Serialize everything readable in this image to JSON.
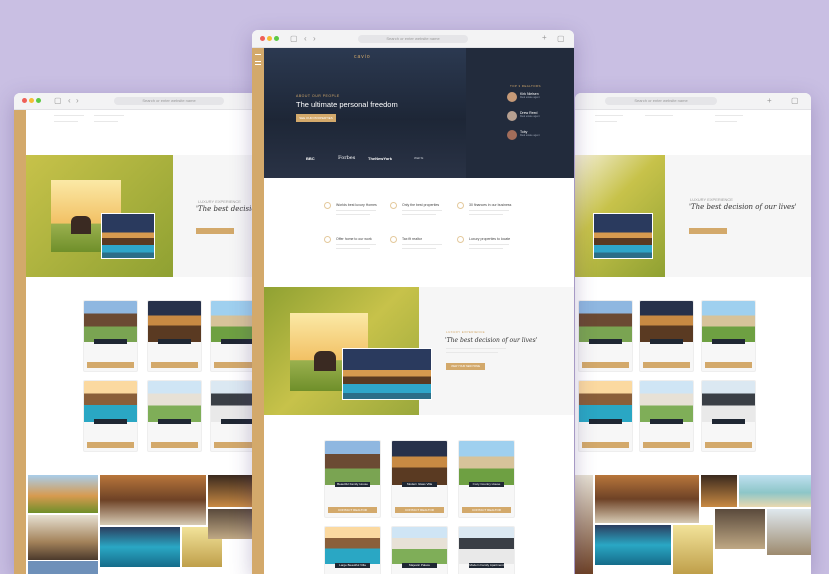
{
  "main": {
    "url": "Search or enter website name",
    "brand": "cavio",
    "eyebrow": "ABOUT OUR PEOPLE",
    "hero_title": "The ultimate personal freedom",
    "hero_button": "SEE OUR PROPERTIES",
    "team_heading": "TOP 3 REALTORS",
    "realtors": [
      {
        "name": "Kirk Nielsen",
        "role": "Real estate agent"
      },
      {
        "name": "Drew Reed",
        "role": "Real estate agent"
      },
      {
        "name": "Toby",
        "role": "Real estate agent"
      }
    ],
    "press": [
      "BBC",
      "Forbes",
      "TheNewYork",
      "Wall St"
    ],
    "features": [
      "Worlds best luxury Homes",
      "Only the best properties",
      "30 finances in our business",
      "Offer home to our work",
      "Tax fit realtor",
      "Luxury properties to locate"
    ],
    "quote_eyebrow": "LUXURY EXPERIENCE",
    "quote": "'The best decision of our lives'",
    "quote_button": "VIEW YOUR NEW HOME",
    "listings": [
      "Beautiful Family House",
      "Modern Glass Villa",
      "Cozy Country House",
      "Large Beautiful Villa",
      "Majestic Palace",
      "Modern Family Apartment"
    ],
    "listing_button": "CONTACT REALTOR"
  },
  "right": {
    "quote": "'The best decision of our lives'"
  },
  "left": {
    "quote": "'The best decision o"
  },
  "colors": {
    "background": "#c9bfe3",
    "accent": "#d3a96b",
    "hero": "#222b3c"
  }
}
